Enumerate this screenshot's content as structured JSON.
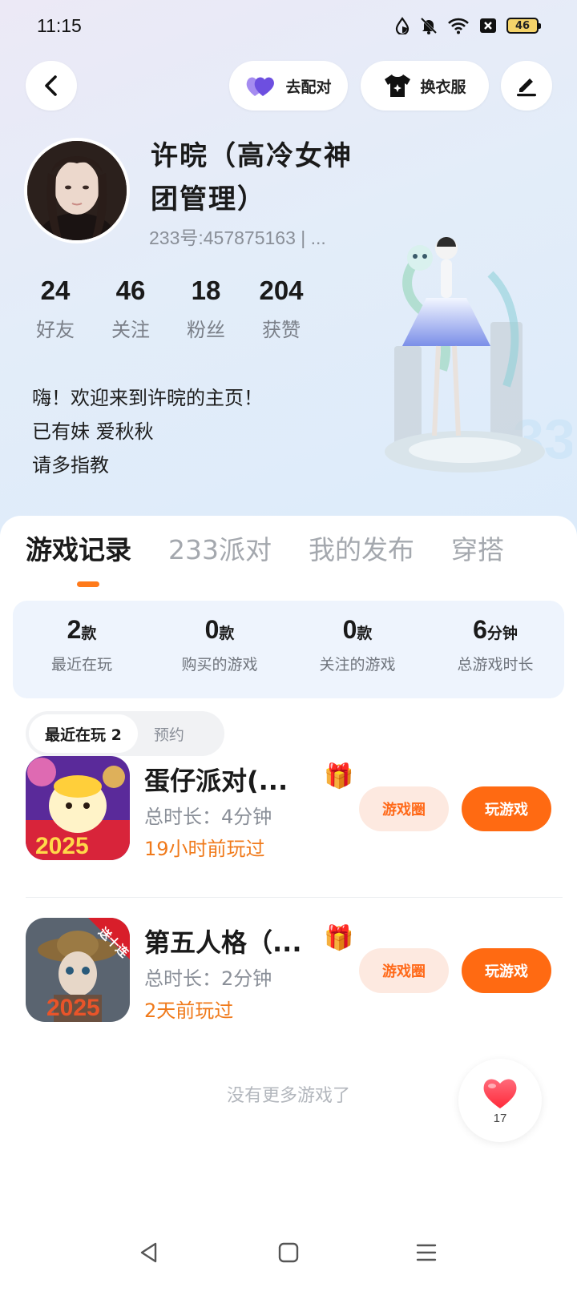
{
  "status_bar": {
    "time": "11:15",
    "battery": "46",
    "icons": [
      "data-saver-icon",
      "mute-icon",
      "wifi-icon",
      "sim-off-icon",
      "battery-icon"
    ]
  },
  "top_actions": {
    "pair_label": "去配对",
    "dress_label": "换衣服"
  },
  "profile": {
    "name": "许晥（高冷女神团管理）",
    "id_line": "233号:457875163 | ..."
  },
  "stats": [
    {
      "value": "24",
      "label": "好友"
    },
    {
      "value": "46",
      "label": "关注"
    },
    {
      "value": "18",
      "label": "粉丝"
    },
    {
      "value": "204",
      "label": "获赞"
    }
  ],
  "bio": {
    "line1": "嗨！欢迎来到许晥的主页！",
    "line2": "已有妹 爱秋秋",
    "line3": "请多指教"
  },
  "tabs": [
    "游戏记录",
    "233派对",
    "我的发布",
    "穿搭"
  ],
  "active_tab": "游戏记录",
  "summary": [
    {
      "value": "2",
      "unit": "款",
      "label": "最近在玩"
    },
    {
      "value": "0",
      "unit": "款",
      "label": "购买的游戏"
    },
    {
      "value": "0",
      "unit": "款",
      "label": "关注的游戏"
    },
    {
      "value": "6",
      "unit": "分钟",
      "label": "总游戏时长"
    }
  ],
  "filters": {
    "recent": "最近在玩 2",
    "reserve": "预约"
  },
  "games": [
    {
      "title": "蛋仔派对(...",
      "duration": "总时长：4分钟",
      "last_played": "19小时前玩过",
      "circle_label": "游戏圈",
      "play_label": "玩游戏",
      "icon_text": "2025"
    },
    {
      "title": "第五人格（...",
      "duration": "总时长：2分钟",
      "last_played": "2天前玩过",
      "circle_label": "游戏圈",
      "play_label": "玩游戏",
      "icon_text": "2025",
      "ribbon": "送十连"
    }
  ],
  "no_more": "没有更多游戏了",
  "likes": "17",
  "colors": {
    "accent": "#ff6a12",
    "accent_soft": "#fde9e0",
    "summary_bg": "#eef4fd"
  }
}
